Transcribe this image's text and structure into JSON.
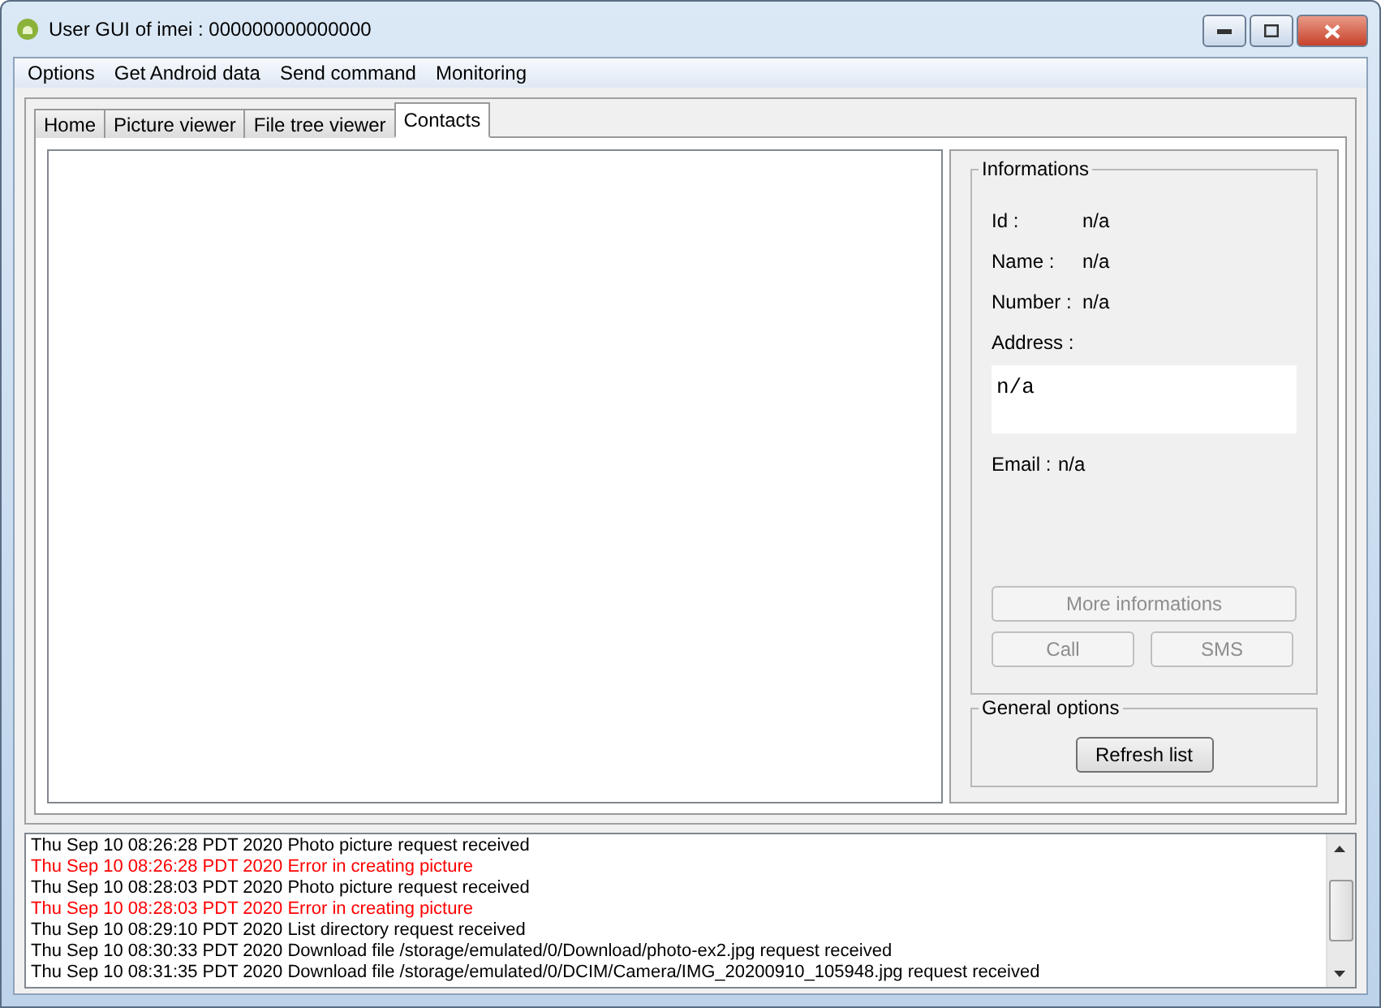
{
  "window": {
    "title": "User GUI of imei : 000000000000000"
  },
  "menu": [
    "Options",
    "Get Android data",
    "Send command",
    "Monitoring"
  ],
  "tabs": [
    {
      "label": "Home",
      "selected": false
    },
    {
      "label": "Picture viewer",
      "selected": false
    },
    {
      "label": "File tree viewer",
      "selected": false
    },
    {
      "label": "Contacts",
      "selected": true
    }
  ],
  "informations": {
    "title": "Informations",
    "fields": [
      {
        "label": "Id :",
        "value": "n/a"
      },
      {
        "label": "Name :",
        "value": "n/a"
      },
      {
        "label": "Number :",
        "value": "n/a"
      }
    ],
    "address_label": "Address :",
    "address": "n/a",
    "email_label": "Email :",
    "email": "n/a",
    "buttons": [
      {
        "label": "More informations",
        "disabled": true
      },
      {
        "label": "Call",
        "disabled": true
      },
      {
        "label": "SMS",
        "disabled": true
      }
    ]
  },
  "general_options": {
    "title": "General options",
    "button": {
      "label": "Refresh list",
      "disabled": false
    }
  },
  "log": [
    {
      "text": "Thu Sep 10 08:26:28 PDT 2020 Photo picture request received",
      "kind": "info"
    },
    {
      "text": "Thu Sep 10 08:26:28 PDT 2020 Error in creating picture",
      "kind": "error"
    },
    {
      "text": "Thu Sep 10 08:28:03 PDT 2020 Photo picture request received",
      "kind": "info"
    },
    {
      "text": "Thu Sep 10 08:28:03 PDT 2020 Error in creating picture",
      "kind": "error"
    },
    {
      "text": "Thu Sep 10 08:29:10 PDT 2020 List directory request received",
      "kind": "info"
    },
    {
      "text": "Thu Sep 10 08:30:33 PDT 2020 Download file /storage/emulated/0/Download/photo-ex2.jpg request received",
      "kind": "info"
    },
    {
      "text": "Thu Sep 10 08:31:35 PDT 2020 Download file /storage/emulated/0/DCIM/Camera/IMG_20200910_105948.jpg request received",
      "kind": "info"
    }
  ]
}
